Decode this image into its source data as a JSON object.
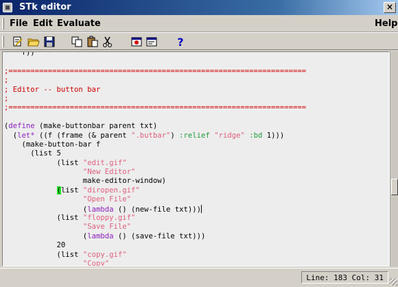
{
  "window": {
    "title": "STk editor",
    "close_glyph": "×"
  },
  "menubar": {
    "file": "File",
    "edit": "Edit",
    "evaluate": "Evaluate",
    "help": "Help"
  },
  "toolbar": {
    "buttons": [
      {
        "name": "new-editor-icon"
      },
      {
        "name": "open-file-icon"
      },
      {
        "name": "save-file-icon"
      },
      {
        "name": "copy-icon"
      },
      {
        "name": "paste-icon"
      },
      {
        "name": "cut-icon"
      },
      {
        "name": "load-icon"
      },
      {
        "name": "window-icon"
      },
      {
        "name": "help-icon"
      }
    ]
  },
  "status": {
    "line_label": "Line:",
    "line": "183",
    "col_label": "Col:",
    "col": "31"
  },
  "code": {
    "lines": [
      [
        [
          "",
          "    f))"
        ]
      ],
      [
        [
          "",
          ""
        ]
      ],
      [
        [
          "c-comment",
          ";===================================================================="
        ]
      ],
      [
        [
          "c-comment",
          ";"
        ]
      ],
      [
        [
          "c-comment",
          "; Editor -- button bar"
        ]
      ],
      [
        [
          "c-comment",
          ";"
        ]
      ],
      [
        [
          "c-comment",
          ";===================================================================="
        ]
      ],
      [
        [
          "",
          ""
        ]
      ],
      [
        [
          "",
          "("
        ],
        [
          "c-kw",
          "define"
        ],
        [
          "",
          " (make-buttonbar parent txt)"
        ]
      ],
      [
        [
          "",
          "  ("
        ],
        [
          "c-kw",
          "let*"
        ],
        [
          "",
          " ((f (frame (& parent "
        ],
        [
          "c-str",
          "\".butbar\""
        ],
        [
          "",
          ") "
        ],
        [
          "c-sym",
          ":relief"
        ],
        [
          "",
          " "
        ],
        [
          "c-str",
          "\"ridge\""
        ],
        [
          "",
          " "
        ],
        [
          "c-sym",
          ":bd"
        ],
        [
          "",
          " 1)))"
        ]
      ],
      [
        [
          "",
          "    (make-button-bar f"
        ]
      ],
      [
        [
          "",
          "      (list 5"
        ]
      ],
      [
        [
          "",
          "            (list "
        ],
        [
          "c-str",
          "\"edit.gif\""
        ]
      ],
      [
        [
          "",
          "                  "
        ],
        [
          "c-str",
          "\"New Editor\""
        ]
      ],
      [
        [
          "",
          "                  make-editor-window)"
        ]
      ],
      [
        [
          "",
          "            "
        ],
        [
          "c-cursor",
          "("
        ],
        [
          "",
          "list "
        ],
        [
          "c-str",
          "\"diropen.gif\""
        ]
      ],
      [
        [
          "",
          "                  "
        ],
        [
          "c-str",
          "\"Open File\""
        ]
      ],
      [
        [
          "",
          "                  ("
        ],
        [
          "c-kw",
          "lambda"
        ],
        [
          "",
          " () (new-file txt)))"
        ],
        [
          "caret",
          ""
        ]
      ],
      [
        [
          "",
          "            (list "
        ],
        [
          "c-str",
          "\"floppy.gif\""
        ]
      ],
      [
        [
          "",
          "                  "
        ],
        [
          "c-str",
          "\"Save File\""
        ]
      ],
      [
        [
          "",
          "                  ("
        ],
        [
          "c-kw",
          "lambda"
        ],
        [
          "",
          " () (save-file txt)))"
        ]
      ],
      [
        [
          "",
          "            20"
        ]
      ],
      [
        [
          "",
          "            (list "
        ],
        [
          "c-str",
          "\"copy.gif\""
        ]
      ],
      [
        [
          "",
          "                  "
        ],
        [
          "c-str",
          "\"Copy\""
        ]
      ]
    ]
  }
}
